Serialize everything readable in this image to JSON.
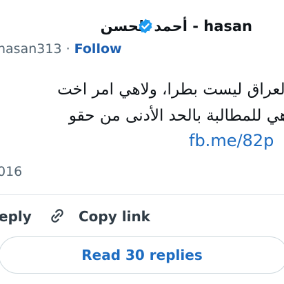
{
  "header": {
    "display_name": "أحمد الحسن - hasan",
    "handle": "hasan313 ·",
    "follow_label": "Follow",
    "verified_icon": "verified-badge-icon",
    "accent_color": "#1d9bf0"
  },
  "tweet": {
    "line1": "العراق ليست بطرا، ولاهي امر اخت",
    "line2": "هي للمطالبة بالحد الأدنى من حقو",
    "link": "fb.me/82p",
    "date": "016"
  },
  "actions": {
    "reply_label": "eply",
    "copy_icon": "link-icon",
    "copy_label": "Copy link",
    "read_replies_label": "Read 30 replies"
  }
}
